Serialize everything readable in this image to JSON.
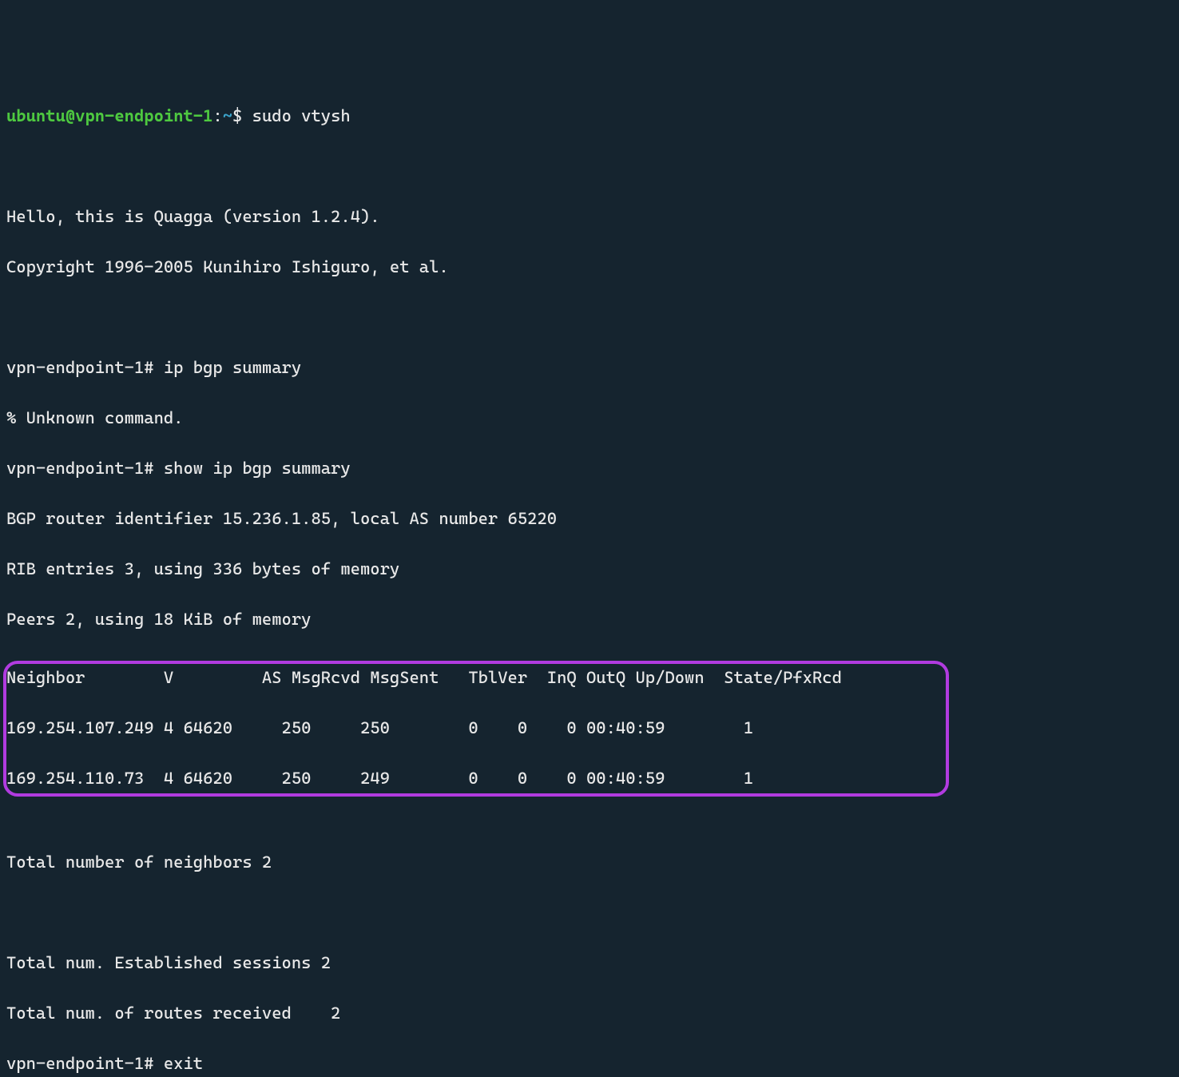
{
  "prompt1": {
    "user": "ubuntu",
    "at": "@",
    "host": "vpn-endpoint-1",
    "colon": ":",
    "tilde": "~",
    "dollar": "$",
    "command": " sudo vtysh"
  },
  "blank1": " ",
  "banner1": "Hello, this is Quagga (version 1.2.4).",
  "banner2": "Copyright 1996-2005 Kunihiro Ishiguro, et al.",
  "blank2": " ",
  "prompt2": "vpn-endpoint-1# ip bgp summary",
  "error1": "% Unknown command.",
  "prompt3": "vpn-endpoint-1# show ip bgp summary",
  "bgp1": "BGP router identifier 15.236.1.85, local AS number 65220",
  "bgp2": "RIB entries 3, using 336 bytes of memory",
  "bgp3": "Peers 2, using 18 KiB of memory",
  "blank3": " ",
  "table_header": "Neighbor        V         AS MsgRcvd MsgSent   TblVer  InQ OutQ Up/Down  State/PfxRcd",
  "table_row1": "169.254.107.249 4 64620     250     250        0    0    0 00:40:59        1",
  "table_row2": "169.254.110.73  4 64620     250     249        0    0    0 00:40:59        1",
  "blank4": " ",
  "total1": "Total number of neighbors 2",
  "blank5": " ",
  "total2": "Total num. Established sessions 2",
  "total3": "Total num. of routes received    2",
  "prompt4": "vpn-endpoint-1# exit"
}
